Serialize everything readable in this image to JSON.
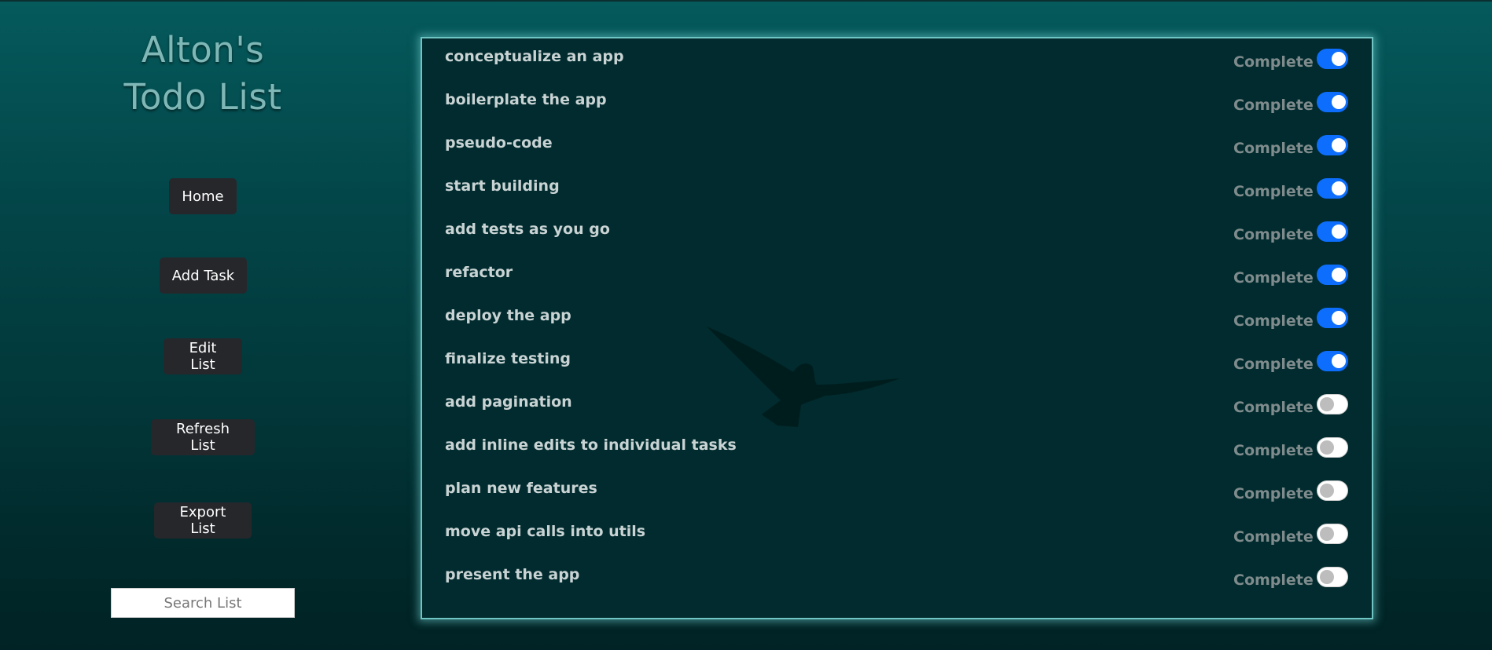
{
  "app": {
    "title_line1": "Alton's",
    "title_line2": "Todo List"
  },
  "nav": {
    "home": "Home",
    "add_task": "Add Task",
    "edit_list": "Edit List",
    "refresh_list": "Refresh List",
    "export_list": "Export List"
  },
  "search": {
    "placeholder": "Search List",
    "value": ""
  },
  "tasks": [
    {
      "label": "conceptualize an app",
      "status_label": "Complete",
      "complete": true
    },
    {
      "label": "boilerplate the app",
      "status_label": "Complete",
      "complete": true
    },
    {
      "label": "pseudo-code",
      "status_label": "Complete",
      "complete": true
    },
    {
      "label": "start building",
      "status_label": "Complete",
      "complete": true
    },
    {
      "label": "add tests as you go",
      "status_label": "Complete",
      "complete": true
    },
    {
      "label": "refactor",
      "status_label": "Complete",
      "complete": true
    },
    {
      "label": "deploy the app",
      "status_label": "Complete",
      "complete": true
    },
    {
      "label": "finalize testing",
      "status_label": "Complete",
      "complete": true
    },
    {
      "label": "add pagination",
      "status_label": "Complete",
      "complete": false
    },
    {
      "label": "add inline edits to individual tasks",
      "status_label": "Complete",
      "complete": false
    },
    {
      "label": "plan new features",
      "status_label": "Complete",
      "complete": false
    },
    {
      "label": "move api calls into utils",
      "status_label": "Complete",
      "complete": false
    },
    {
      "label": "present the app",
      "status_label": "Complete",
      "complete": false
    }
  ],
  "colors": {
    "toggle_on": "#0d6efd",
    "panel_border": "#6fc4c4",
    "button_bg": "#26272b"
  },
  "icons": {
    "background_image": "bird-silhouette"
  }
}
